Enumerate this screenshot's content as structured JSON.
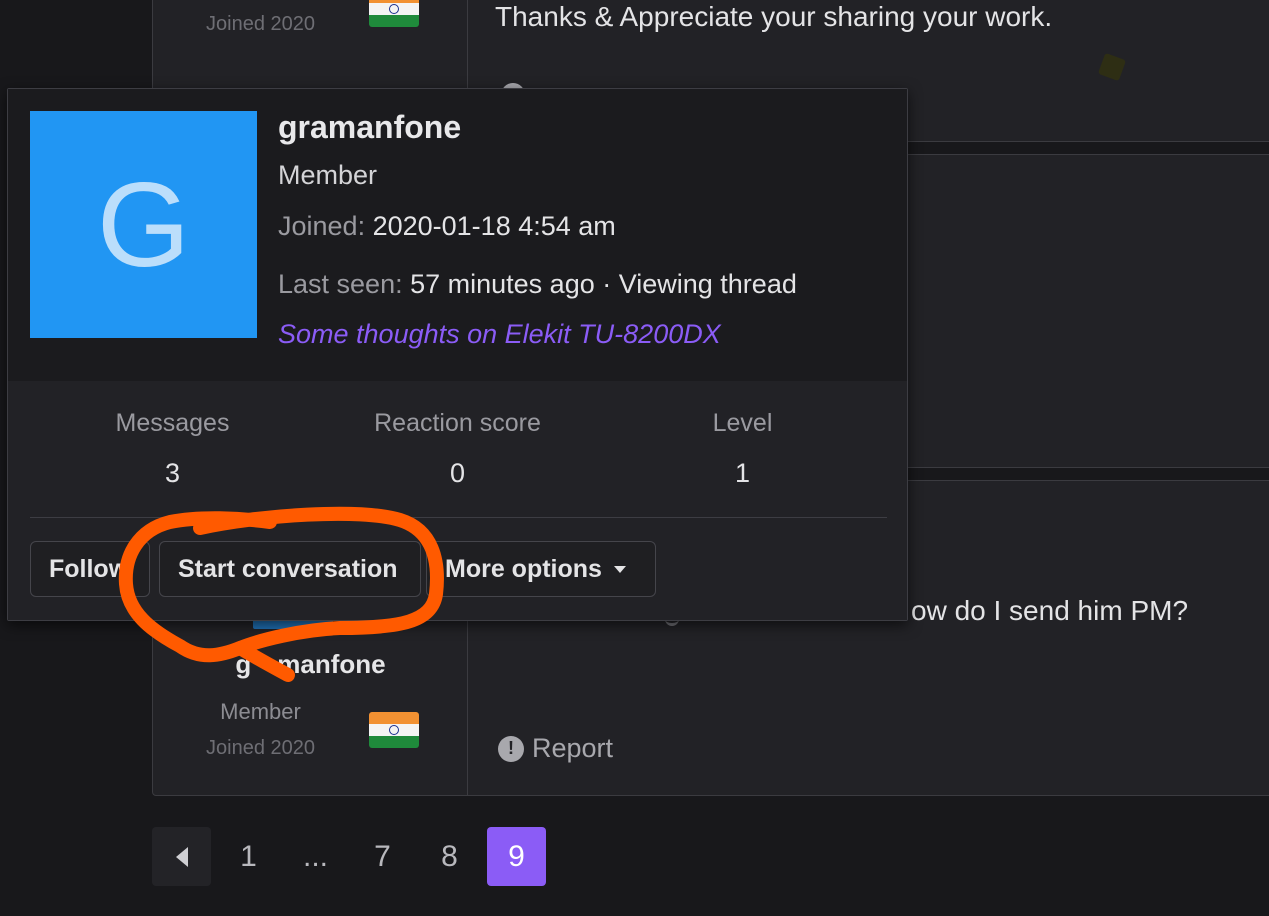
{
  "posts": [
    {
      "user_joined": "Joined 2020",
      "text": "Thanks & Appreciate your sharing your work."
    },
    {
      "user_name_partial_left": "g",
      "user_name_partial_right": "manfone",
      "user_title": "Member",
      "user_joined": "Joined 2020",
      "text_partial": "ow do I send him PM?",
      "report_label": "Report"
    }
  ],
  "tooltip": {
    "avatar_letter": "G",
    "name": "gramanfone",
    "title": "Member",
    "joined_label": "Joined:",
    "joined_value": "2020-01-18 4:54 am",
    "last_seen_label": "Last seen:",
    "last_seen_value": "57 minutes ago · Viewing thread",
    "activity_link": "Some thoughts on Elekit TU-8200DX",
    "stats": [
      {
        "label": "Messages",
        "value": "3"
      },
      {
        "label": "Reaction score",
        "value": "0"
      },
      {
        "label": "Level",
        "value": "1"
      }
    ],
    "buttons": {
      "follow": "Follow",
      "start_conversation": "Start conversation",
      "more_options": "More options"
    }
  },
  "pagination": {
    "pages": [
      "1",
      "...",
      "7",
      "8"
    ],
    "current": "9"
  },
  "colors": {
    "accent": "#8b5cf6",
    "avatar_bg": "#2196f3",
    "annotation": "#ff5a00"
  }
}
